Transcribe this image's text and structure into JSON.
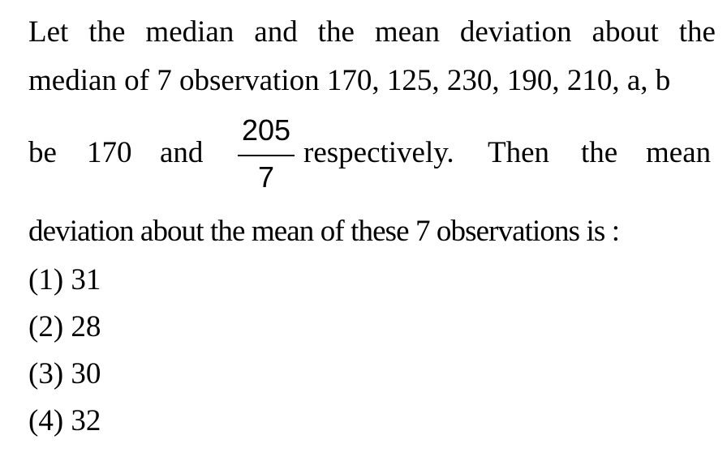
{
  "question": {
    "line1": [
      "Let",
      "the",
      "median",
      "and",
      "the",
      "mean",
      "deviation",
      "about",
      "the"
    ],
    "line2": "median of 7 observation 170, 125, 230, 190, 210, a, b",
    "line3": {
      "before_1": "be",
      "before_2": "170",
      "before_3": "and",
      "fraction_numerator": "205",
      "fraction_denominator": "7",
      "after_1": "respectively.",
      "after_2": "Then",
      "after_3": "the",
      "after_4": "mean"
    },
    "line4": "deviation about the mean of these 7 observations is :"
  },
  "options": [
    "(1) 31",
    "(2) 28",
    "(3) 30",
    "(4) 32"
  ]
}
